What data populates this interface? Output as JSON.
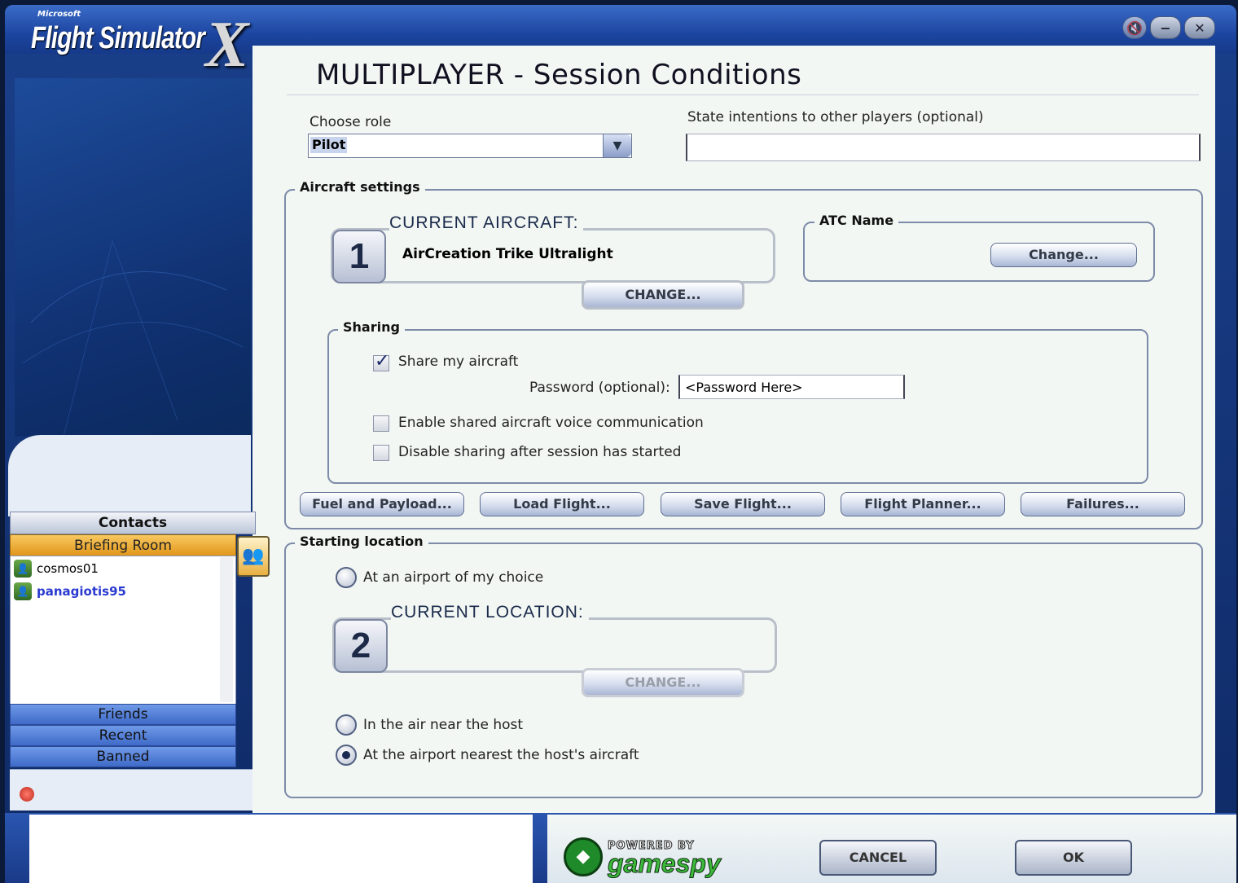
{
  "window": {
    "ms_label": "Microsoft",
    "logo_text": "Flight Simulator",
    "logo_x": "X",
    "title": "MULTIPLAYER - Session Conditions"
  },
  "role": {
    "label": "Choose role",
    "value": "Pilot"
  },
  "intentions": {
    "label": "State intentions to other players (optional)",
    "value": ""
  },
  "aircraft_settings": {
    "label": "Aircraft settings",
    "current_aircraft_label": "CURRENT AIRCRAFT:",
    "slot_number": "1",
    "aircraft_name": "AirCreation Trike Ultralight",
    "change_label": "CHANGE...",
    "atc_label": "ATC Name",
    "atc_change_label": "Change..."
  },
  "sharing": {
    "label": "Sharing",
    "share_my_aircraft": {
      "label": "Share my aircraft",
      "checked": true
    },
    "password_label": "Password (optional):",
    "password_value": "<Password Here>",
    "enable_voice": {
      "label": "Enable shared aircraft voice communication",
      "checked": false
    },
    "disable_after": {
      "label": "Disable sharing after session has started",
      "checked": false
    }
  },
  "action_buttons": [
    "Fuel and Payload...",
    "Load Flight...",
    "Save Flight...",
    "Flight Planner...",
    "Failures..."
  ],
  "starting_location": {
    "label": "Starting location",
    "option_airport_choice": "At an airport of my choice",
    "current_location_label": "CURRENT LOCATION:",
    "slot_number": "2",
    "location_name": "",
    "change_label": "CHANGE...",
    "option_air_near_host": "In the air near the host",
    "option_nearest_host_airport": "At the airport nearest the host's aircraft",
    "selected": "option_nearest_host_airport"
  },
  "contacts": {
    "header": "Contacts",
    "briefing_room": "Briefing Room",
    "users": [
      "cosmos01",
      "panagiotis95"
    ],
    "tabs": [
      "Friends",
      "Recent",
      "Banned"
    ]
  },
  "footer": {
    "powered_by": "POWERED BY",
    "gamespy": "gamespy",
    "cancel": "CANCEL",
    "ok": "OK"
  },
  "colors": {
    "accent": "#1c45a0",
    "briefing": "#f0b030",
    "selected_user": "#2a3ad0"
  }
}
